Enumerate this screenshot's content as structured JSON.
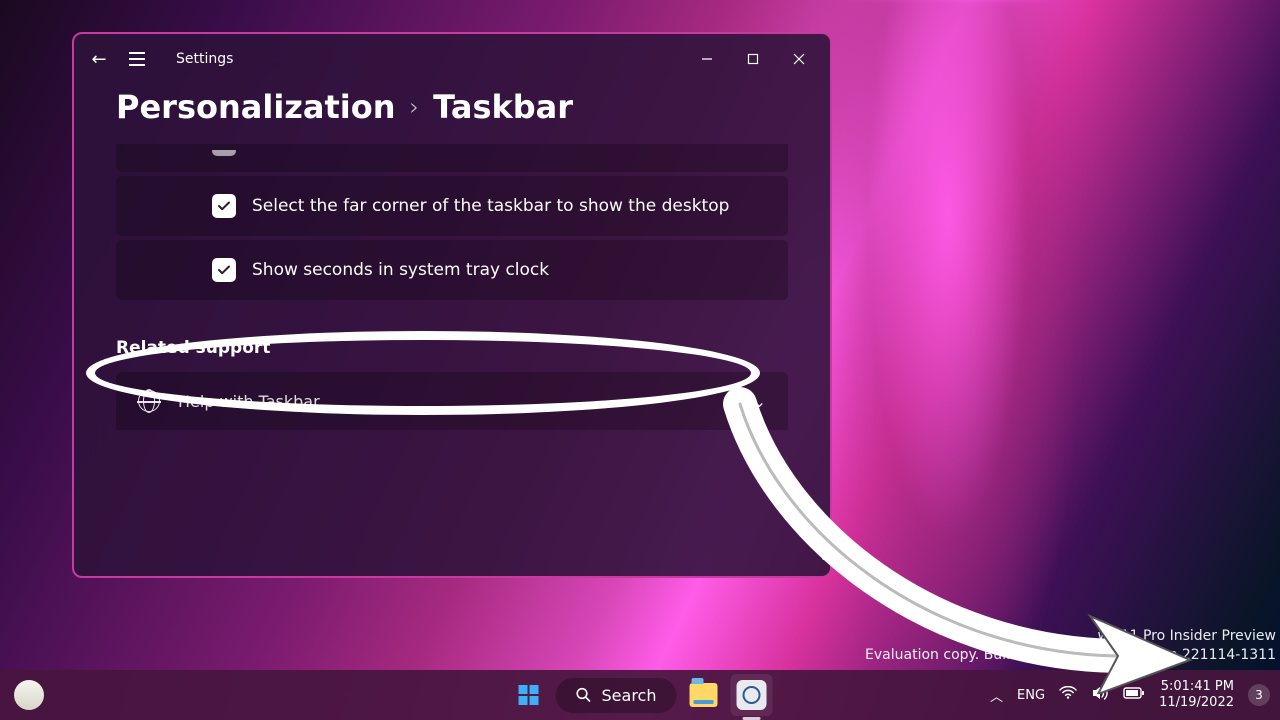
{
  "window": {
    "app_title": "Settings",
    "breadcrumb": {
      "parent": "Personalization",
      "chev": "›",
      "current": "Taskbar"
    },
    "settings": [
      {
        "checked": true,
        "label": "Select the far corner of the taskbar to show the desktop"
      },
      {
        "checked": true,
        "label": "Show seconds in system tray clock"
      }
    ],
    "related_heading": "Related support",
    "help_item": "Help with Taskbar"
  },
  "watermark": {
    "line1": "ws 11 Pro Insider Preview",
    "line2": "Evaluation copy. Build                     rerelease.221114-1311"
  },
  "taskbar": {
    "search_label": "Search",
    "lang": "ENG",
    "time": "5:01:41 PM",
    "date": "11/19/2022",
    "notif_count": "3"
  }
}
